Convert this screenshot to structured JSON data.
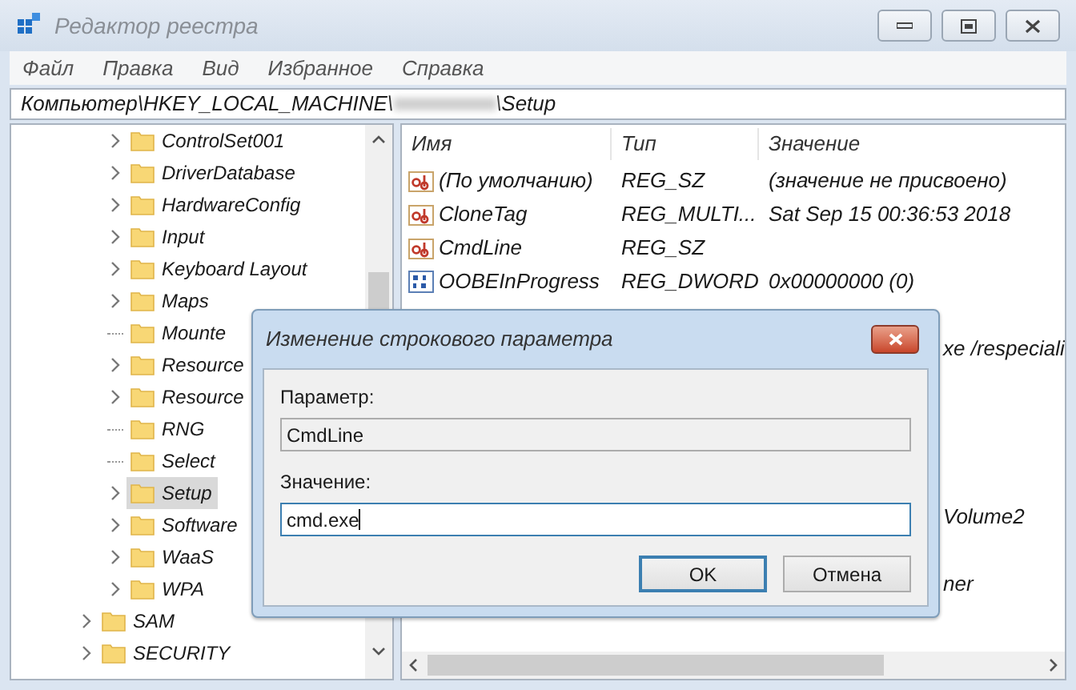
{
  "window": {
    "title": "Редактор реестра"
  },
  "menu": [
    "Файл",
    "Правка",
    "Вид",
    "Избранное",
    "Справка"
  ],
  "address": {
    "start": "Компьютер\\HKEY_LOCAL_MACHINE\\",
    "end": "\\Setup"
  },
  "tree": [
    {
      "children": [
        {
          "label": "ControlSet001",
          "expandable": true,
          "selected": false
        },
        {
          "label": "DriverDatabase",
          "expandable": true,
          "selected": false
        },
        {
          "label": "HardwareConfig",
          "expandable": true,
          "selected": false
        },
        {
          "label": "Input",
          "expandable": true,
          "selected": false
        },
        {
          "label": "Keyboard Layout",
          "expandable": true,
          "selected": false
        },
        {
          "label": "Maps",
          "expandable": true,
          "selected": false
        },
        {
          "label": "Mounte",
          "expandable": false,
          "selected": false
        },
        {
          "label": "Resource",
          "expandable": true,
          "selected": false
        },
        {
          "label": "Resource",
          "expandable": true,
          "selected": false
        },
        {
          "label": "RNG",
          "expandable": false,
          "selected": false
        },
        {
          "label": "Select",
          "expandable": false,
          "selected": false
        },
        {
          "label": "Setup",
          "expandable": true,
          "selected": true
        },
        {
          "label": "Software",
          "expandable": true,
          "selected": false
        },
        {
          "label": "WaaS",
          "expandable": true,
          "selected": false
        },
        {
          "label": "WPA",
          "expandable": true,
          "selected": false
        }
      ]
    },
    {
      "label": "SAM",
      "expandable": true,
      "selected": false
    },
    {
      "label": "SECURITY",
      "expandable": true,
      "selected": false
    }
  ],
  "table": {
    "columns": [
      "Имя",
      "Тип",
      "Значение"
    ],
    "rows": [
      {
        "kind": "string",
        "name": "(По умолчанию)",
        "type": "REG_SZ",
        "value": "(значение не присвоено)"
      },
      {
        "kind": "string",
        "name": "CloneTag",
        "type": "REG_MULTI...",
        "value": "Sat Sep 15 00:36:53 2018"
      },
      {
        "kind": "string",
        "name": "CmdLine",
        "type": "REG_SZ",
        "value": ""
      },
      {
        "kind": "binary",
        "name": "OOBEInProgress",
        "type": "REG_DWORD",
        "value": "0x00000000 (0)"
      },
      {
        "kind": "covered",
        "tail": ""
      },
      {
        "kind": "covered",
        "tail": "xe /respeciali"
      },
      {
        "kind": "covered",
        "tail": ""
      },
      {
        "kind": "covered",
        "tail": ""
      },
      {
        "kind": "covered",
        "tail": ""
      },
      {
        "kind": "covered",
        "tail": ""
      },
      {
        "kind": "covered",
        "tail": "Volume2"
      },
      {
        "kind": "covered",
        "tail": ""
      },
      {
        "kind": "covered",
        "tail": "ner"
      }
    ]
  },
  "dialog": {
    "title": "Изменение строкового параметра",
    "name_label": "Параметр:",
    "name_value": "CmdLine",
    "value_label": "Значение:",
    "value": "cmd.exe",
    "buttons": [
      {
        "label": "OK",
        "default": true
      },
      {
        "label": "Отмена",
        "default": false
      }
    ]
  }
}
